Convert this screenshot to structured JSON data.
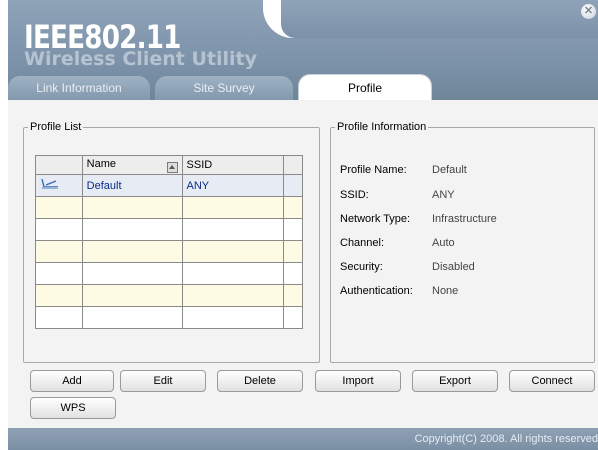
{
  "app": {
    "logo": "IEEE802.11",
    "subtitle": "Wireless Client Utility"
  },
  "tabs": [
    {
      "label": "Link Information",
      "active": false
    },
    {
      "label": "Site Survey",
      "active": false
    },
    {
      "label": "Profile",
      "active": true
    }
  ],
  "profile_list": {
    "legend": "Profile List",
    "columns": [
      "Name",
      "SSID"
    ],
    "rows": [
      {
        "name": "Default",
        "ssid": "ANY"
      }
    ]
  },
  "profile_info": {
    "legend": "Profile Information",
    "fields": [
      {
        "label": "Profile Name:",
        "value": "Default"
      },
      {
        "label": "SSID:",
        "value": "ANY"
      },
      {
        "label": "Network Type:",
        "value": "Infrastructure"
      },
      {
        "label": "Channel:",
        "value": "Auto"
      },
      {
        "label": "Security:",
        "value": "Disabled"
      },
      {
        "label": "Authentication:",
        "value": "None"
      }
    ]
  },
  "buttons": {
    "add": "Add",
    "edit": "Edit",
    "delete": "Delete",
    "import": "Import",
    "export": "Export",
    "connect": "Connect",
    "wps": "WPS"
  },
  "footer": {
    "copyright": "Copyright(C) 2008. All rights reserved"
  },
  "colors": {
    "header": "#7d93aa",
    "selected_row": "#e7ebf3",
    "alt_row": "#fdfbe4"
  }
}
